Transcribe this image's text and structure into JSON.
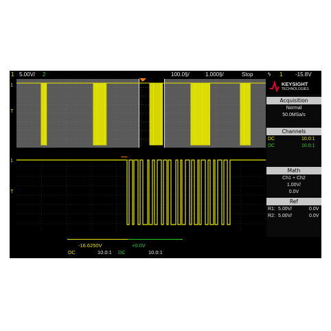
{
  "topbar": {
    "ch1_number": "1",
    "ch1_scale": "5.00V/",
    "ch2_number": "2",
    "timebase_position": "100.0§/",
    "timebase_scale": "1.000§/",
    "run_state": "Stop",
    "trigger_icon": "ϟ",
    "trigger_source": "1",
    "trigger_level": "-15.8V"
  },
  "brand": {
    "name": "KEYSIGHT",
    "sub": "TECHNOLOGIES"
  },
  "acquisition": {
    "header": "Acquisition",
    "mode": "Normal",
    "rate": "50.0MSa/s"
  },
  "channels": {
    "header": "Channels",
    "rows": [
      {
        "coupling": "DC",
        "probe": "10.0:1"
      },
      {
        "coupling": "DC",
        "probe": "10.0:1"
      }
    ]
  },
  "math": {
    "header": "Math",
    "func": "Ch1 + Ch2",
    "scale": "1.00V/",
    "offset": "0.0V"
  },
  "ref": {
    "header": "Ref",
    "rows": [
      {
        "name": "R1:",
        "scale": "5.00V/",
        "offset": "0.0V"
      },
      {
        "name": "R2:",
        "scale": "5.00V/",
        "offset": "0.0V"
      }
    ]
  },
  "bottombar": {
    "ch1_offset": "-16.6250V",
    "ch2_offset": "+0.0V",
    "ch1_coupling": "DC",
    "ch1_probe": "10.0:1",
    "ch2_coupling": "DC",
    "ch2_probe": "10.0:1"
  },
  "markers": {
    "ch1": "1",
    "trig": "T"
  },
  "colors": {
    "ch1": "#e6e600",
    "ch2": "#25d025",
    "accent": "#ff7a00",
    "logo": "#e3002b"
  }
}
